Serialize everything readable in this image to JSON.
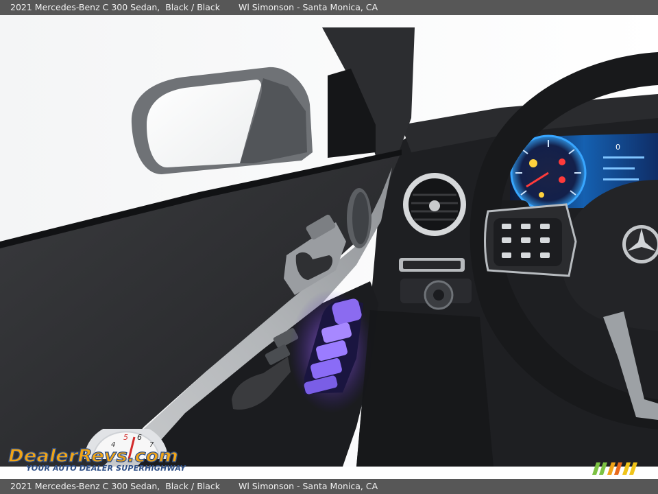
{
  "caption": {
    "vehicle": "2021 Mercedes-Benz C 300 Sedan,",
    "colors": "Black / Black",
    "dealer": "Wl Simonson - Santa Monica, CA"
  },
  "watermark": {
    "logo_text": "DealerRevs.com",
    "tagline": "YOUR AUTO DEALER SUPERHIGHWAY"
  },
  "cluster": {
    "trip_label": "0"
  }
}
